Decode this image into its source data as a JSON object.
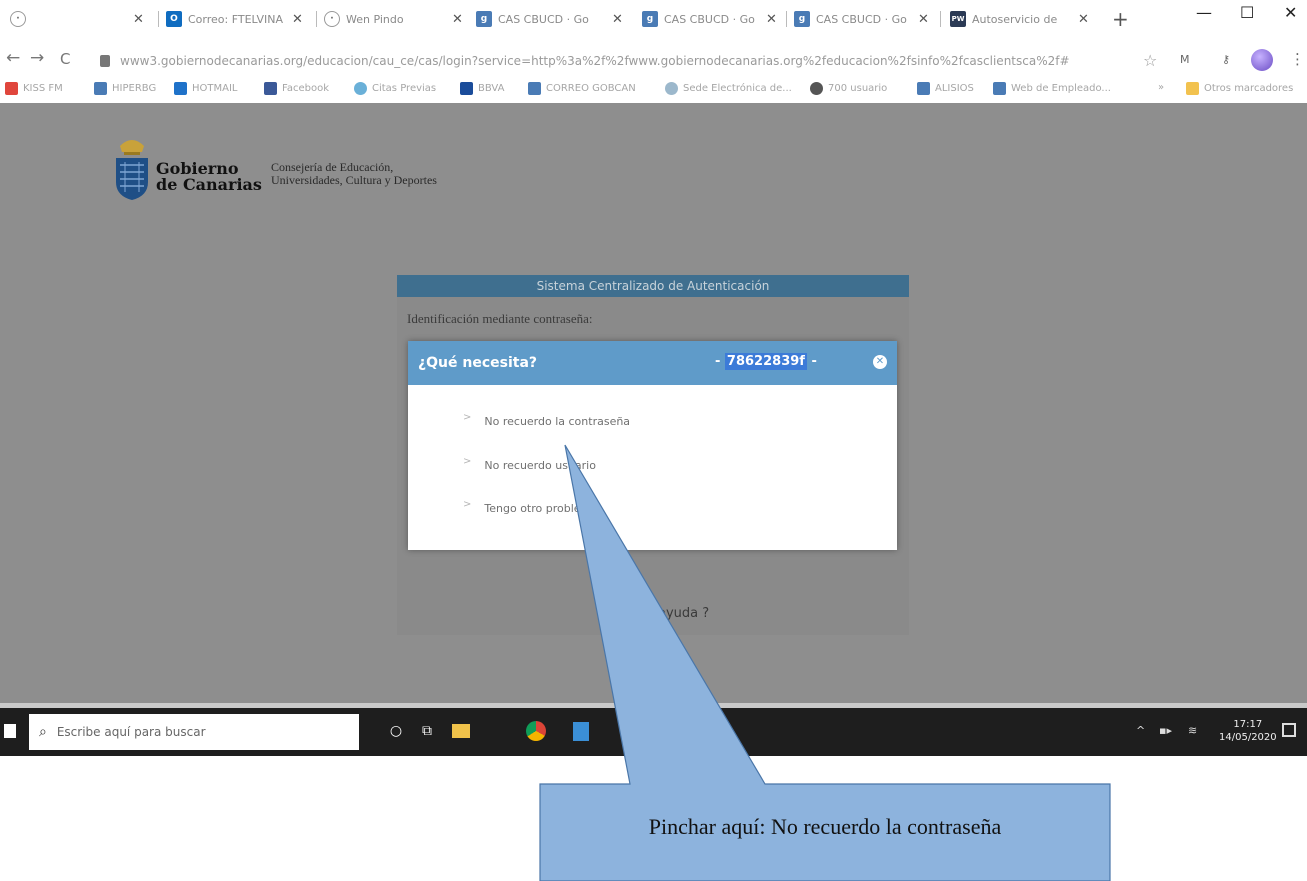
{
  "browser": {
    "tabs": [
      {
        "title": "",
        "favicon": "globe-icon"
      },
      {
        "title": "Correo: FTELVINA",
        "favicon": "outlook-icon"
      },
      {
        "title": "Wen Pindo",
        "favicon": "globe-icon"
      },
      {
        "title": "CAS CBUCD · Go",
        "favicon": "gobcan-icon"
      },
      {
        "title": "CAS CBUCD · Go",
        "favicon": "gobcan-icon"
      },
      {
        "title": "CAS CBUCD · Go",
        "favicon": "gobcan-icon"
      },
      {
        "title": "Autoservicio de",
        "favicon": "pw-icon"
      }
    ],
    "url": "www3.gobiernodecanarias.org/educacion/cau_ce/cas/login?service=http%3a%2f%2fwww.gobiernodecanarias.org%2feducacion%2fsinfo%2fcasclientsca%2f#",
    "bookmarks": [
      {
        "label": "KISS FM",
        "color": "#e0463c"
      },
      {
        "label": "HIPERBG",
        "color": "#4a7bb5"
      },
      {
        "label": "HOTMAIL",
        "color": "#1f72c9"
      },
      {
        "label": "Facebook",
        "color": "#3b5998"
      },
      {
        "label": "Citas Previas",
        "color": "#6ab0d8"
      },
      {
        "label": "BBVA",
        "color": "#1a4c9a"
      },
      {
        "label": "CORREO GOBCAN",
        "color": "#4a7bb5"
      },
      {
        "label": "Sede Electrónica de...",
        "color": "#9cb8cc"
      },
      {
        "label": "700 usuario",
        "color": "#555555"
      },
      {
        "label": "ALISIOS",
        "color": "#4a7bb5"
      },
      {
        "label": "Web de Empleado...",
        "color": "#4a7bb5"
      },
      {
        "label": "Otros marcadores",
        "color": "#f2c24f"
      }
    ],
    "more_bookmarks": "»"
  },
  "page": {
    "org_line1": "Gobierno",
    "org_line2": "de Canarias",
    "dept_line1": "Consejería de Educación,",
    "dept_line2": "Universidades, Cultura y Deportes",
    "panel_title": "Sistema Centralizado de Autenticación",
    "panel_subtitle": "Identificación mediante contraseña:",
    "help_text": "ayuda ?"
  },
  "modal": {
    "title": "¿Qué necesita?",
    "code_prefix": "- ",
    "code": "78622839f",
    "code_suffix": " -",
    "options": [
      "No recuerdo la contraseña",
      "No recuerdo usuario",
      "Tengo otro problema"
    ]
  },
  "taskbar": {
    "search_placeholder": "Escribe aquí para buscar",
    "time": "17:17",
    "date": "14/05/2020"
  },
  "callout": {
    "text": "Pinchar aquí: No recuerdo la contraseña",
    "fill": "#8db3dd",
    "stroke": "#4a76a8"
  },
  "colors": {
    "modal_header": "#5f9bc9",
    "panel_header": "#3f6f8f",
    "overlay": "#8e8e8e"
  }
}
